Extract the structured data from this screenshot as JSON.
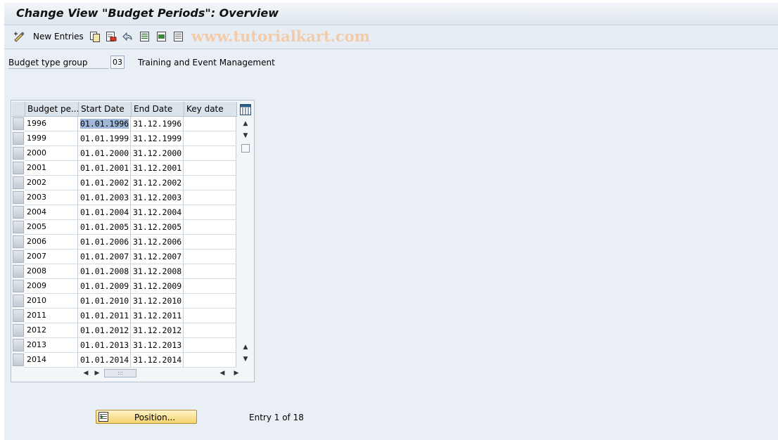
{
  "window": {
    "title": "Change View \"Budget Periods\": Overview"
  },
  "toolbar": {
    "new_entries_label": "New Entries",
    "watermark": "www.tutorialkart.com"
  },
  "header_fields": {
    "budget_type_group_label": "Budget type group",
    "budget_type_group_value": "03",
    "budget_type_group_description": "Training and Event Management"
  },
  "table": {
    "columns": [
      "Budget pe...",
      "Start Date",
      "End Date",
      "Key date"
    ],
    "rows": [
      [
        "1996",
        "01.01.1996",
        "31.12.1996",
        ""
      ],
      [
        "1999",
        "01.01.1999",
        "31.12.1999",
        ""
      ],
      [
        "2000",
        "01.01.2000",
        "31.12.2000",
        ""
      ],
      [
        "2001",
        "01.01.2001",
        "31.12.2001",
        ""
      ],
      [
        "2002",
        "01.01.2002",
        "31.12.2002",
        ""
      ],
      [
        "2003",
        "01.01.2003",
        "31.12.2003",
        ""
      ],
      [
        "2004",
        "01.01.2004",
        "31.12.2004",
        ""
      ],
      [
        "2005",
        "01.01.2005",
        "31.12.2005",
        ""
      ],
      [
        "2006",
        "01.01.2006",
        "31.12.2006",
        ""
      ],
      [
        "2007",
        "01.01.2007",
        "31.12.2007",
        ""
      ],
      [
        "2008",
        "01.01.2008",
        "31.12.2008",
        ""
      ],
      [
        "2009",
        "01.01.2009",
        "31.12.2009",
        ""
      ],
      [
        "2010",
        "01.01.2010",
        "31.12.2010",
        ""
      ],
      [
        "2011",
        "01.01.2011",
        "31.12.2011",
        ""
      ],
      [
        "2012",
        "01.01.2012",
        "31.12.2012",
        ""
      ],
      [
        "2013",
        "01.01.2013",
        "31.12.2013",
        ""
      ],
      [
        "2014",
        "01.01.2014",
        "31.12.2014",
        ""
      ]
    ]
  },
  "footer": {
    "position_button_label": "Position...",
    "entry_info": "Entry 1 of 18"
  }
}
